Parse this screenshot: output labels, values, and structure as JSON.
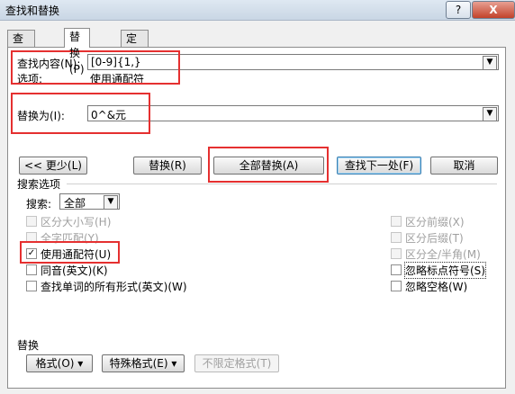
{
  "window": {
    "title": "查找和替换",
    "help_label": "?",
    "close_label": "X"
  },
  "tabs": [
    {
      "label": "查找(D)"
    },
    {
      "label": "替换(P)"
    },
    {
      "label": "定位(G)"
    }
  ],
  "find": {
    "label": "查找内容(N):",
    "value": "[0-9]{1,}",
    "options_label": "选项:",
    "options_value": "使用通配符"
  },
  "replace": {
    "label": "替换为(I):",
    "value": "0^&元"
  },
  "buttons": {
    "less": "<< 更少(L)",
    "replace": "替换(R)",
    "replace_all": "全部替换(A)",
    "find_next": "查找下一处(F)",
    "cancel": "取消"
  },
  "search_options": {
    "title": "搜索选项",
    "search_label": "搜索:",
    "search_value": "全部",
    "left": [
      {
        "label": "区分大小写(H)",
        "checked": false,
        "disabled": true
      },
      {
        "label": "全字匹配(Y)",
        "checked": false,
        "disabled": true
      },
      {
        "label": "使用通配符(U)",
        "checked": true,
        "disabled": false
      },
      {
        "label": "同音(英文)(K)",
        "checked": false,
        "disabled": false
      },
      {
        "label": "查找单词的所有形式(英文)(W)",
        "checked": false,
        "disabled": false
      }
    ],
    "right": [
      {
        "label": "区分前缀(X)",
        "checked": false,
        "disabled": true
      },
      {
        "label": "区分后缀(T)",
        "checked": false,
        "disabled": true
      },
      {
        "label": "区分全/半角(M)",
        "checked": false,
        "disabled": true
      },
      {
        "label": "忽略标点符号(S)",
        "checked": false,
        "disabled": false
      },
      {
        "label": "忽略空格(W)",
        "checked": false,
        "disabled": false
      }
    ]
  },
  "replace_section": {
    "title": "替换",
    "format_button": "格式(O) ▾",
    "special_button": "特殊格式(E) ▾",
    "no_format_button": "不限定格式(T)"
  }
}
